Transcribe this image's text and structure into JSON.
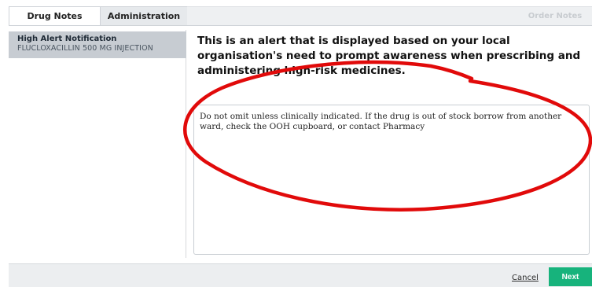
{
  "tabs": {
    "drug_notes": "Drug Notes",
    "administration": "Administration",
    "order_notes": "Order Notes"
  },
  "sidebar": {
    "items": [
      {
        "title": "High Alert Notification",
        "subtitle": "FLUCLOXACILLIN 500 MG INJECTION"
      }
    ]
  },
  "main": {
    "heading": "This is an alert that is displayed based on your local organisation's need to prompt awareness when prescribing and administering high-risk medicines.",
    "note_text": "Do not omit unless clinically indicated. If the drug is out of stock borrow from another ward, check the OOH cupboard, or contact Pharmacy"
  },
  "footer": {
    "cancel_label": "Cancel",
    "next_label": "Next"
  },
  "colors": {
    "next_button": "#17b37c",
    "sidebar_selected": "#c7ccd2",
    "annotation_circle": "#e10a0a"
  }
}
